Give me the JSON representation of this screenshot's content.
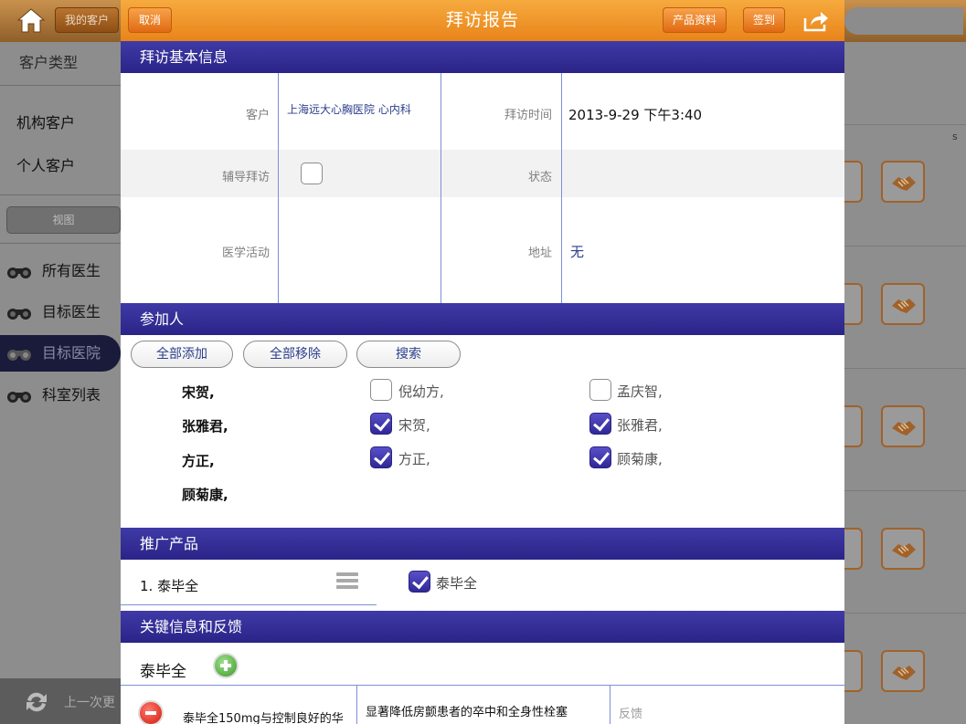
{
  "background": {
    "topbar": {
      "my_customers_label": "我的客户"
    },
    "sidebar": {
      "header": "客户类型",
      "items": [
        "机构客户",
        "个人客户"
      ],
      "view_label": "视图",
      "doctor_items": [
        "所有医生",
        "目标医生",
        "目标医院",
        "科室列表"
      ],
      "selected": "目标医院",
      "bottom_label": "上一次更"
    },
    "right_letter": "s"
  },
  "modal": {
    "title": "拜访报告",
    "cancel_label": "取消",
    "product_info_label": "产品资料",
    "checkin_label": "签到",
    "sections": {
      "basic": "拜访基本信息",
      "participants": "参加人",
      "products": "推广产品",
      "key_info": "关键信息和反馈"
    },
    "basic_info": {
      "customer_label": "客户",
      "customer_value": "上海远大心胸医院 心内科",
      "visit_time_label": "拜访时间",
      "visit_time_value": "2013-9-29 下午3:40",
      "assisted_label": "辅导拜访",
      "assisted_checked": false,
      "status_label": "状态",
      "medical_activity_label": "医学活动",
      "address_label": "地址",
      "address_value": "无"
    },
    "participants": {
      "buttons": [
        "全部添加",
        "全部移除",
        "搜索"
      ],
      "selected": [
        "宋贺,",
        "张雅君,",
        "方正,",
        "顾菊康,"
      ],
      "candidates": [
        {
          "name": "倪幼方,",
          "checked": false
        },
        {
          "name": "孟庆智,",
          "checked": false
        },
        {
          "name": "宋贺,",
          "checked": true
        },
        {
          "name": "张雅君,",
          "checked": true
        },
        {
          "name": "方正,",
          "checked": true
        },
        {
          "name": "顾菊康,",
          "checked": true
        }
      ]
    },
    "products": {
      "list": [
        "1.  泰毕全"
      ],
      "options": [
        {
          "name": "泰毕全",
          "checked": true
        }
      ]
    },
    "key_info": {
      "product": "泰毕全",
      "message": "泰毕全150mg与控制良好的华",
      "benefit": "显著降低房颤患者的卒中和全身性栓塞",
      "feedback_label": "反馈"
    }
  },
  "colors": {
    "header_orange": "#f09a30",
    "section_purple": "#2f2896",
    "link_blue": "#2b3f8c"
  }
}
